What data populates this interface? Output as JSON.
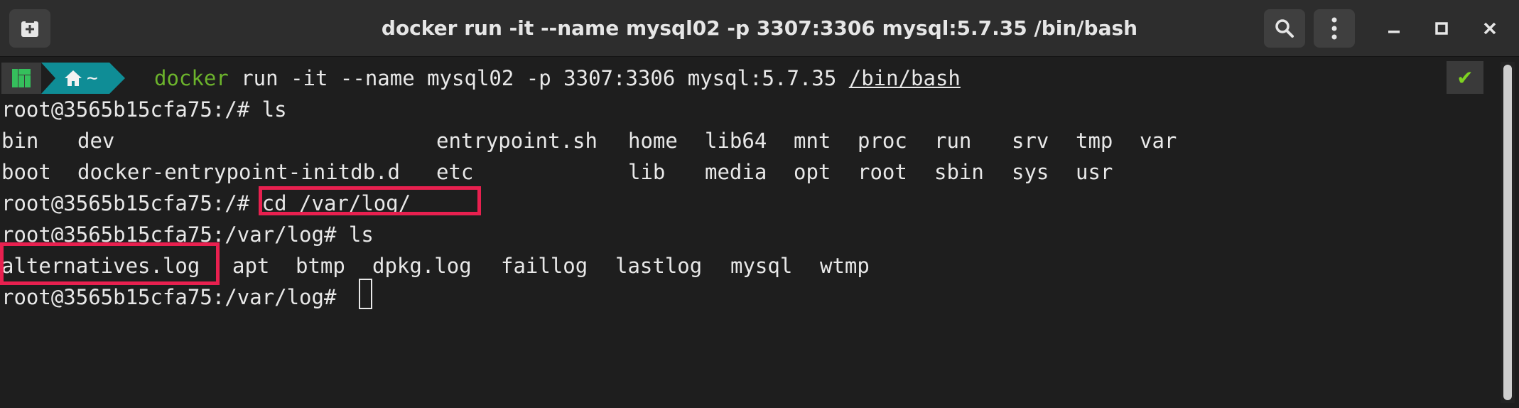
{
  "window": {
    "title": "docker run -it --name mysql02 -p 3307:3306 mysql:5.7.35 /bin/bash",
    "buttons": {
      "new_tab": "new-tab-icon",
      "search": "search-icon",
      "menu": "kebab-menu-icon",
      "minimize": "minimize-icon",
      "maximize": "maximize-icon",
      "close": "close-icon"
    }
  },
  "prompt_bar": {
    "home_symbol": "~",
    "command_name": "docker",
    "command_args": " run -it --name mysql02 -p 3307:3306 mysql:5.7.35 ",
    "command_path": "/bin/bash",
    "status_mark": "✔"
  },
  "terminal": {
    "line1": {
      "prompt": "root@3565b15cfa75:/# ",
      "command": "ls"
    },
    "ls_root": {
      "row1": [
        "bin",
        "dev",
        "entrypoint.sh",
        "home",
        "lib64",
        "mnt",
        "proc",
        "run",
        "srv",
        "tmp",
        "var"
      ],
      "row2": [
        "boot",
        "docker-entrypoint-initdb.d",
        "etc",
        "lib",
        "media",
        "opt",
        "root",
        "sbin",
        "sys",
        "usr"
      ]
    },
    "line4": {
      "prompt": "root@3565b15cfa75:/# ",
      "command": "cd /var/log/"
    },
    "line5": {
      "prompt": "root@3565b15cfa75:/var/log# ",
      "command": "ls"
    },
    "ls_log": [
      "alternatives.log",
      "apt",
      "btmp",
      "dpkg.log",
      "faillog",
      "lastlog",
      "mysql",
      "wtmp"
    ],
    "line7": {
      "prompt": "root@3565b15cfa75:/var/log# ",
      "command": ""
    }
  },
  "colors": {
    "background": "#1e1e1e",
    "titlebar": "#2d2d2d",
    "accent_teal": "#0f8d96",
    "command_green": "#6cb42c",
    "highlight_red": "#e8204f",
    "status_green": "#7ed321"
  }
}
